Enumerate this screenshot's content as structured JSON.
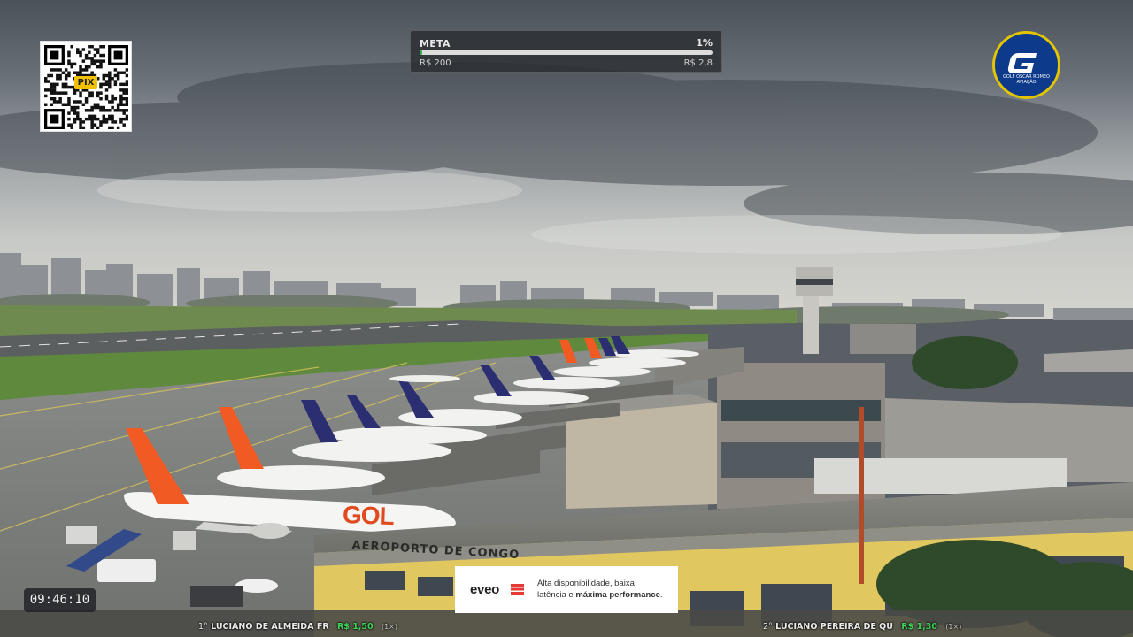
{
  "qr": {
    "label": "PIX"
  },
  "goal": {
    "label": "META",
    "percent_text": "1%",
    "progress": 0.01,
    "min_text": "R$ 200",
    "max_text": "R$ 2,8"
  },
  "brand": {
    "lines": [
      "GOLF OSCAR ROMEO",
      "AVIAÇÃO"
    ]
  },
  "clock": {
    "time": "09:46:10"
  },
  "terminal_sign": "AEROPORTO DE CONGO",
  "aircraft_livery": "GOL",
  "ad": {
    "brand": "eveo",
    "line1": "Alta disponibilidade, baixa",
    "line2_prefix": "latência e ",
    "line2_bold": "máxima performance",
    "line2_suffix": "."
  },
  "donors": [
    {
      "rank": "1°",
      "name": "LUCIANO DE ALMEIDA FR",
      "amount": "R$ 1,50",
      "mult": "(1×)"
    },
    {
      "rank": "2°",
      "name": "LUCIANO PEREIRA DE QU",
      "amount": "R$ 1,30",
      "mult": "(1×)"
    }
  ],
  "colors": {
    "progress": "#2fb24a",
    "amount": "#3fd45a",
    "gol_orange": "#f15a22",
    "latam_navy": "#2b2f72"
  }
}
